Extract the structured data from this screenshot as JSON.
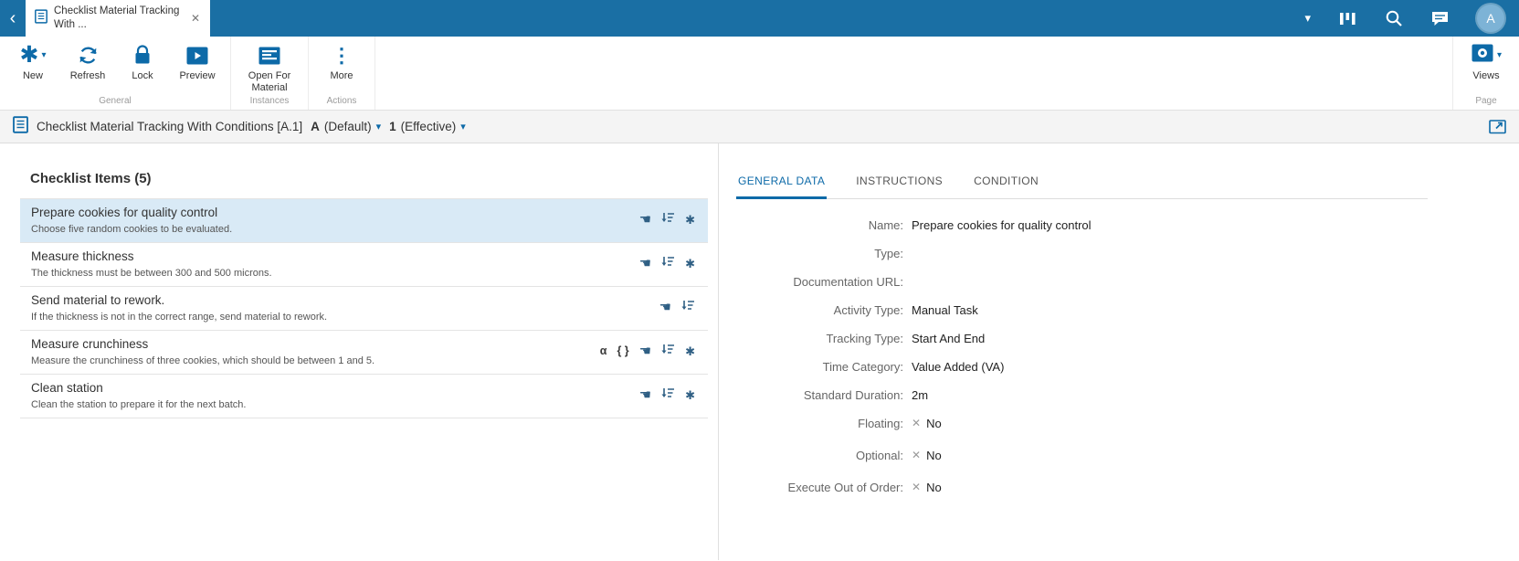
{
  "glyphs": {
    "back": "‹",
    "close": "✕",
    "caret": "▾",
    "asterisk": "✱",
    "more": "⋮",
    "hand": "☚",
    "alpha": "α",
    "braces": "{ }",
    "x": "✕"
  },
  "topbar": {
    "tab_title": "Checklist Material Tracking With ...",
    "avatar": "A"
  },
  "ribbon": {
    "new": "New",
    "refresh": "Refresh",
    "lock": "Lock",
    "preview": "Preview",
    "open_for_material": "Open For Material",
    "more": "More",
    "views": "Views",
    "groups": {
      "general": "General",
      "instances": "Instances",
      "actions": "Actions",
      "page": "Page"
    }
  },
  "breadcrumb": {
    "title": "Checklist Material Tracking With Conditions [A.1]",
    "revision_key": "A",
    "revision_state": "(Default)",
    "version_key": "1",
    "version_state": "(Effective)"
  },
  "checklist": {
    "heading": "Checklist Items (5)",
    "items": [
      {
        "title": "Prepare cookies for quality control",
        "subtitle": "Choose five random cookies to be evaluated."
      },
      {
        "title": "Measure thickness",
        "subtitle": "The thickness must be between 300 and 500 microns."
      },
      {
        "title": "Send material to rework.",
        "subtitle": "If the thickness is not in the correct range, send material to rework."
      },
      {
        "title": "Measure crunchiness",
        "subtitle": "Measure the crunchiness of three cookies, which should be between 1 and 5."
      },
      {
        "title": "Clean station",
        "subtitle": "Clean the station to prepare it for the next batch."
      }
    ]
  },
  "detail": {
    "tabs": [
      "GENERAL DATA",
      "INSTRUCTIONS",
      "CONDITION"
    ],
    "fields": [
      {
        "label": "Name:",
        "value": "Prepare cookies for quality control"
      },
      {
        "label": "Type:",
        "value": ""
      },
      {
        "label": "Documentation URL:",
        "value": ""
      },
      {
        "label": "Activity Type:",
        "value": "Manual Task"
      },
      {
        "label": "Tracking Type:",
        "value": "Start And End"
      },
      {
        "label": "Time Category:",
        "value": "Value Added (VA)"
      },
      {
        "label": "Standard Duration:",
        "value": "2m"
      },
      {
        "label": "Floating:",
        "value": "No"
      },
      {
        "label": "Optional:",
        "value": "No"
      },
      {
        "label": "Execute Out of Order:",
        "value": "No"
      }
    ]
  }
}
